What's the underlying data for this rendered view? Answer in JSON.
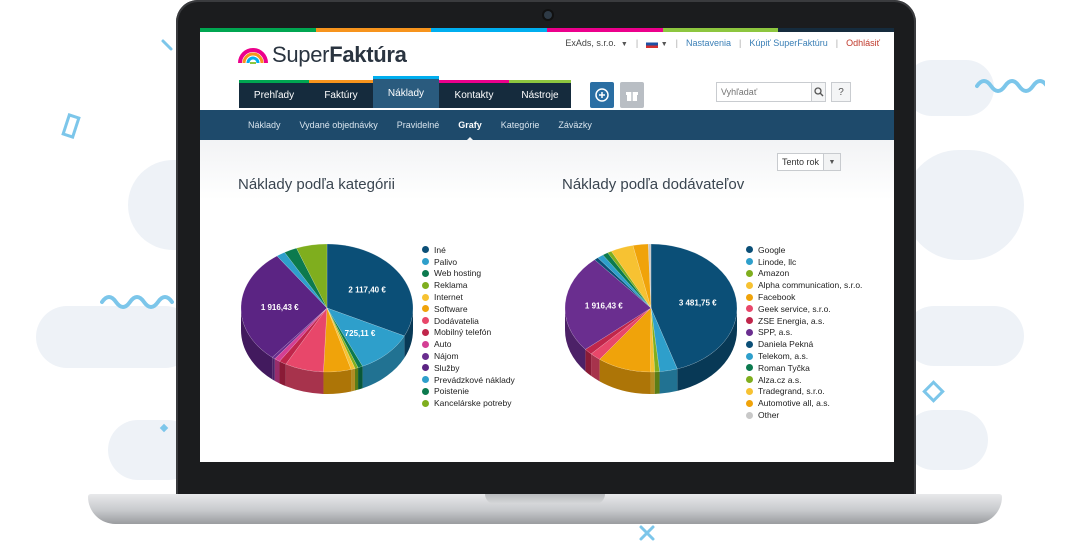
{
  "app": {
    "logo_light": "Super",
    "logo_bold": "Faktúra"
  },
  "topbar": {
    "company": "ExAds, s.r.o.",
    "settings": "Nastavenia",
    "buy": "Kúpiť SuperFaktúru",
    "logout": "Odhlásiť"
  },
  "tabs": [
    {
      "label": "Prehľady",
      "accent": "#00a651"
    },
    {
      "label": "Faktúry",
      "accent": "#f7941d"
    },
    {
      "label": "Náklady",
      "accent": "#00aeef",
      "active": true
    },
    {
      "label": "Kontakty",
      "accent": "#ec008c"
    },
    {
      "label": "Nástroje",
      "accent": "#8dc63f"
    }
  ],
  "search": {
    "placeholder": "Vyhľadať"
  },
  "help_label": "?",
  "subnav": [
    "Náklady",
    "Vydané objednávky",
    "Pravidelné",
    "Grafy",
    "Kategórie",
    "Záväzky"
  ],
  "subnav_active": "Grafy",
  "period": {
    "label": "Tento rok"
  },
  "chart_data": [
    {
      "type": "pie",
      "title": "Náklady podľa kategórii",
      "legend_position": "right",
      "categories": [
        "Iné",
        "Palivo",
        "Web hosting",
        "Reklama",
        "Internet",
        "Software",
        "Dodávatelia",
        "Mobilný telefón",
        "Auto",
        "Nájom",
        "Služby",
        "Prevádzkové náklady",
        "Poistenie",
        "Kancelárske potreby"
      ],
      "colors": [
        "#0b4f77",
        "#2e9fcb",
        "#0c7a4e",
        "#7fae1e",
        "#f7c232",
        "#f0a30a",
        "#e8476a",
        "#c0264b",
        "#d43f94",
        "#6a2e8f",
        "#5b2483",
        "#2e9fcb",
        "#0c7a4e",
        "#7fae1e"
      ],
      "values": [
        2117.4,
        725.11,
        60,
        40,
        50,
        340,
        480,
        90,
        70,
        40,
        1916.43,
        110,
        160,
        380
      ],
      "data_labels": [
        "2 117,40 €",
        "725,11 €",
        "",
        "",
        "",
        "",
        "",
        "",
        "",
        "",
        "1 916,43 €",
        "",
        "",
        ""
      ]
    },
    {
      "type": "pie",
      "title": "Náklady podľa dodávateľov",
      "legend_position": "right",
      "categories": [
        "Google",
        "Linode, llc",
        "Amazon",
        "Alpha communication, s.r.o.",
        "Facebook",
        "Geek service, s.r.o.",
        "ZSE Energia, a.s.",
        "SPP, a.s.",
        "Daniela Pekná",
        "Telekom, a.s.",
        "Roman Tyčka",
        "Alza.cz a.s.",
        "Tradegrand, s.r.o.",
        "Automotive all, a.s.",
        "Other"
      ],
      "colors": [
        "#0b4f77",
        "#2e9fcb",
        "#7fae1e",
        "#f7c232",
        "#f0a30a",
        "#e8476a",
        "#c0264b",
        "#6a2e8f",
        "#0b4f77",
        "#2e9fcb",
        "#0c7a4e",
        "#7fae1e",
        "#f7c232",
        "#f0a30a",
        "#c8c8c8"
      ],
      "values": [
        3481.75,
        260,
        70,
        60,
        780,
        160,
        120,
        1916.43,
        60,
        90,
        80,
        60,
        330,
        220,
        40
      ],
      "data_labels": [
        "3 481,75 €",
        "",
        "",
        "",
        "",
        "",
        "",
        "1 916,43 €",
        "",
        "",
        "",
        "",
        "",
        "",
        ""
      ]
    }
  ]
}
